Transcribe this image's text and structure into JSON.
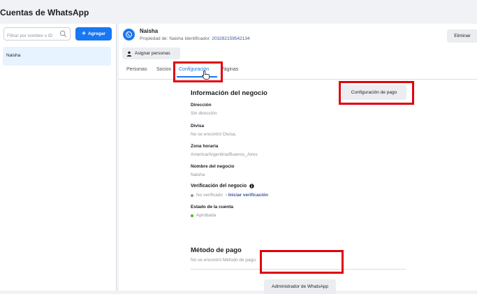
{
  "page": {
    "title": "Cuentas de WhatsApp"
  },
  "sidebar": {
    "filter_placeholder": "Filtrar por nombre o ID",
    "add_button_label": "Agregar",
    "accounts": [
      {
        "name": "Naisha"
      }
    ]
  },
  "account": {
    "name": "Naisha",
    "owner_prefix": "Propiedad de: Naisha  Identificador:",
    "id_value": "203282159542134",
    "delete_button": "Eliminar",
    "assign_button": "Asignar personas"
  },
  "tabs": [
    {
      "label": "Personas"
    },
    {
      "label": "Socios"
    },
    {
      "label": "Configuración",
      "active": true
    },
    {
      "label": "Páginas"
    }
  ],
  "business_info": {
    "title": "Información del negocio",
    "payment_config_button": "Configuración de pago",
    "fields": {
      "address": {
        "label": "Dirección",
        "value": "Sin dirección"
      },
      "currency": {
        "label": "Divisa",
        "value": "No se encontró Divisa."
      },
      "timezone": {
        "label": "Zona horaria",
        "value": "America/Argentina/Buenos_Aires"
      },
      "business_name": {
        "label": "Nombre del negocio",
        "value": "Naisha"
      },
      "verification": {
        "label": "Verificación del negocio",
        "status": "No verificado",
        "link": "- Iniciar verificación"
      },
      "account_status": {
        "label": "Estado de la cuenta",
        "status": "Aprobada"
      }
    },
    "payment_method": {
      "title": "Método de pago",
      "value": "No se encontró Método de pago."
    },
    "wa_manager_button": "Administrador de WhatsApp"
  },
  "colors": {
    "accent": "#1877f2",
    "highlight": "#e0000b",
    "approved": "#42b72a",
    "unverified": "#8d949e"
  },
  "icons": {
    "search": "magnifier",
    "whatsapp": "whatsapp-logo",
    "person": "person-silhouette",
    "info": "info-circle",
    "cursor": "hand-pointer"
  }
}
